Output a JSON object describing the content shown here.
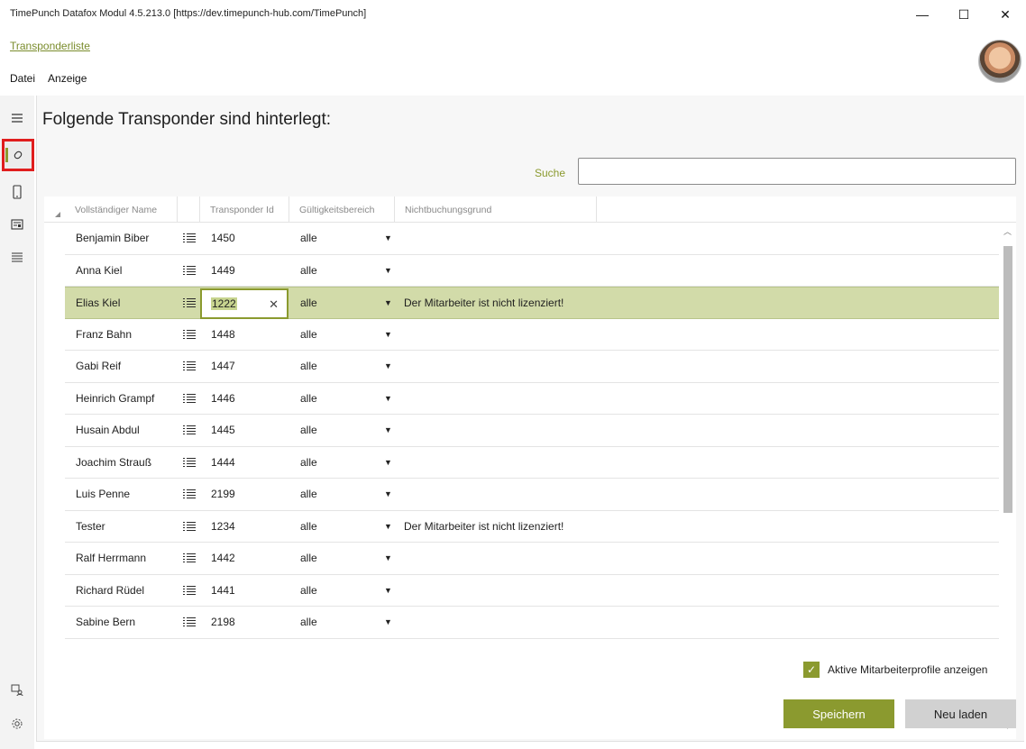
{
  "window": {
    "title": "TimePunch Datafox Modul 4.5.213.0 [https://dev.timepunch-hub.com/TimePunch]",
    "minimize": "—",
    "maximize": "☐",
    "close": "✕"
  },
  "breadcrumb": "Transponderliste",
  "menu": [
    "Datei",
    "Anzeige"
  ],
  "sidebar": {
    "icons": [
      "menu-icon",
      "tag-icon",
      "device-icon",
      "card-reader-icon",
      "list-icon"
    ],
    "bottom_icons": [
      "user-search-icon",
      "gear-icon"
    ]
  },
  "page": {
    "heading": "Folgende Transponder sind hinterlegt:",
    "search_label": "Suche",
    "search_value": ""
  },
  "table": {
    "columns": [
      "Vollständiger Name",
      "",
      "Transponder Id",
      "Gültigkeitsbereich",
      "Nichtbuchungsgrund"
    ],
    "rows": [
      {
        "name": "Benjamin Biber",
        "id": "1450",
        "scope": "alle",
        "reason": ""
      },
      {
        "name": "Anna Kiel",
        "id": "1449",
        "scope": "alle",
        "reason": ""
      },
      {
        "name": "Elias Kiel",
        "id": "1222",
        "scope": "alle",
        "reason": "Der Mitarbeiter ist nicht lizenziert!"
      },
      {
        "name": "Franz Bahn",
        "id": "1448",
        "scope": "alle",
        "reason": ""
      },
      {
        "name": "Gabi Reif",
        "id": "1447",
        "scope": "alle",
        "reason": ""
      },
      {
        "name": "Heinrich Grampf",
        "id": "1446",
        "scope": "alle",
        "reason": ""
      },
      {
        "name": "Husain Abdul",
        "id": "1445",
        "scope": "alle",
        "reason": ""
      },
      {
        "name": "Joachim Strauß",
        "id": "1444",
        "scope": "alle",
        "reason": ""
      },
      {
        "name": "Luis Penne",
        "id": "2199",
        "scope": "alle",
        "reason": ""
      },
      {
        "name": "Tester",
        "id": "1234",
        "scope": "alle",
        "reason": "Der Mitarbeiter ist nicht lizenziert!"
      },
      {
        "name": "Ralf Herrmann",
        "id": "1442",
        "scope": "alle",
        "reason": ""
      },
      {
        "name": "Richard Rüdel",
        "id": "1441",
        "scope": "alle",
        "reason": ""
      },
      {
        "name": "Sabine Bern",
        "id": "2198",
        "scope": "alle",
        "reason": ""
      }
    ],
    "selected_row": 2
  },
  "footer": {
    "checkbox_label": "Aktive Mitarbeiterprofile anzeigen",
    "checkbox_checked": true,
    "save_label": "Speichern",
    "reload_label": "Neu laden"
  },
  "colors": {
    "accent": "#8b9a2f",
    "selected_row": "#d2dba9",
    "highlight_border": "#e01d1d"
  }
}
